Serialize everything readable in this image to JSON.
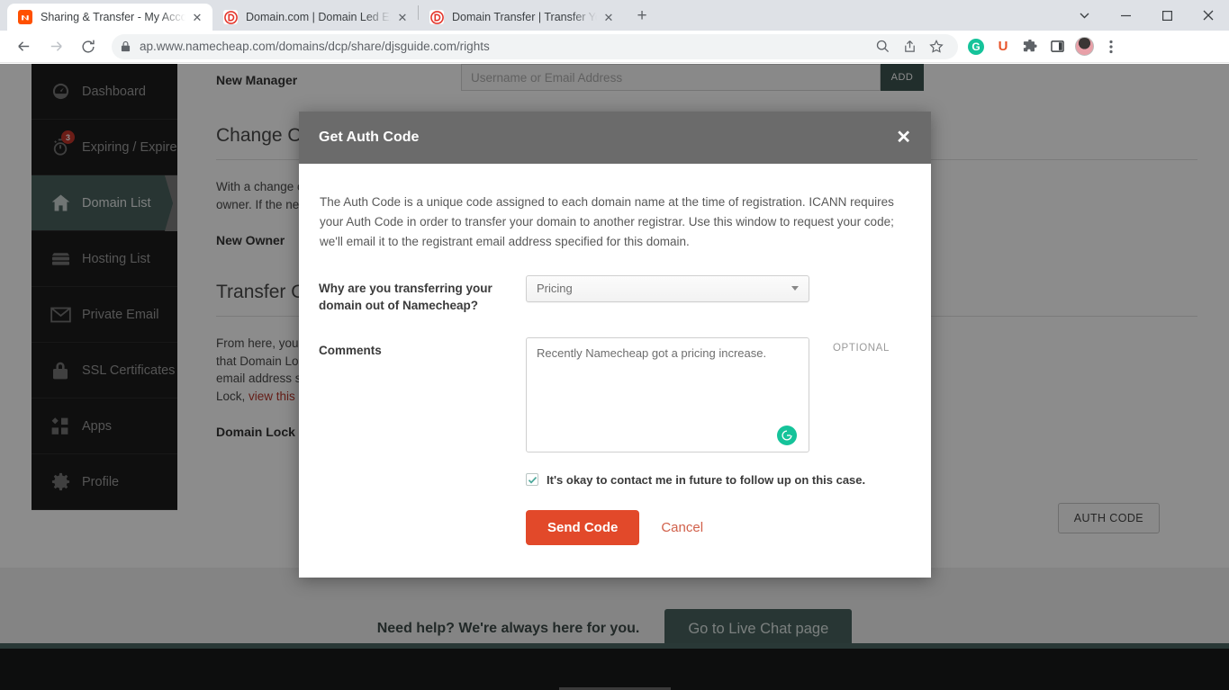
{
  "browser": {
    "tabs": [
      {
        "title": "Sharing & Transfer - My Account",
        "favicon": "namecheap-icon",
        "active": true,
        "close_label": "✕"
      },
      {
        "title": "Domain.com | Domain Led Experi",
        "favicon": "domaincom-icon",
        "active": false,
        "close_label": "✕"
      },
      {
        "title": "Domain Transfer | Transfer Your D",
        "favicon": "domaincom-icon",
        "active": false,
        "close_label": "✕"
      }
    ],
    "new_tab_label": "+",
    "window_controls": {
      "minimize": "–",
      "maximize": "□",
      "close": "✕",
      "expand": "⌄"
    },
    "nav": {
      "back": "←",
      "forward": "→",
      "reload": "↻"
    },
    "omnibox": {
      "url": "ap.www.namecheap.com/domains/dcp/share/djsguide.com/rights",
      "lock_icon": "lock-icon"
    },
    "toolbar_icons": [
      "search-icon",
      "share-icon",
      "bookmark-star-icon",
      "grammarly-extension-icon",
      "unstoppable-extension-icon",
      "extensions-puzzle-icon",
      "side-panel-icon",
      "profile-avatar",
      "chrome-menu-icon"
    ],
    "extension_labels": {
      "grammarly": "G",
      "unstoppable": "U"
    }
  },
  "sidebar": {
    "items": [
      {
        "label": "Dashboard",
        "icon": "dashboard-gauge-icon",
        "active": false,
        "badge": null
      },
      {
        "label": "Expiring / Expired",
        "icon": "stopwatch-icon",
        "active": false,
        "badge": "3"
      },
      {
        "label": "Domain List",
        "icon": "house-icon",
        "active": true,
        "badge": null
      },
      {
        "label": "Hosting List",
        "icon": "server-icon",
        "active": false,
        "badge": null
      },
      {
        "label": "Private Email",
        "icon": "envelope-icon",
        "active": false,
        "badge": null
      },
      {
        "label": "SSL Certificates",
        "icon": "padlock-icon",
        "active": false,
        "badge": null
      },
      {
        "label": "Apps",
        "icon": "apps-grid-icon",
        "active": false,
        "badge": null
      },
      {
        "label": "Profile",
        "icon": "gear-icon",
        "active": false,
        "badge": null
      }
    ]
  },
  "page": {
    "new_manager_label": "New Manager",
    "new_manager_placeholder": "Username or Email Address",
    "add_button": "ADD",
    "change_owner_title": "Change Ow",
    "change_owner_text_line1": "With a change o",
    "change_owner_text_line2": "owner. If the ne",
    "new_owner_label": "New Owner",
    "transfer_out_title": "Transfer Ou",
    "transfer_text_line1": "From here, you",
    "transfer_text_line2": "that Domain Loc",
    "transfer_text_line3": "email address sp",
    "transfer_text_line4_pre": "Lock, ",
    "transfer_text_link": "view this K",
    "domain_lock_label": "Domain Lock",
    "auth_code_button": "AUTH CODE"
  },
  "help": {
    "text": "Need help? We're always here for you.",
    "chat_button": "Go to Live Chat page"
  },
  "modal": {
    "title": "Get Auth Code",
    "close_label": "✕",
    "description": "The Auth Code is a unique code assigned to each domain name at the time of registration. ICANN requires your Auth Code in order to transfer your domain to another registrar. Use this window to request your code; we'll email it to the registrant email address specified for this domain.",
    "reason_label": "Why are you transferring your domain out of Namecheap?",
    "reason_value": "Pricing",
    "reason_options": [
      "Pricing"
    ],
    "comments_label": "Comments",
    "comments_value": "Recently Namecheap got a pricing increase.",
    "comments_optional": "OPTIONAL",
    "grammarly_icon": "grammarly-icon",
    "consent_checked": true,
    "consent_label": "It's okay to contact me in future to follow up on this case.",
    "send_button": "Send Code",
    "cancel_button": "Cancel"
  },
  "colors": {
    "accent_red": "#e2492a",
    "cancel_red": "#d1604a",
    "sidebar_active": "#4a615e",
    "chat_button": "#49635f",
    "grammarly_green": "#15c39a",
    "badge_red": "#c4352b",
    "modal_header": "#6b6b6b"
  }
}
